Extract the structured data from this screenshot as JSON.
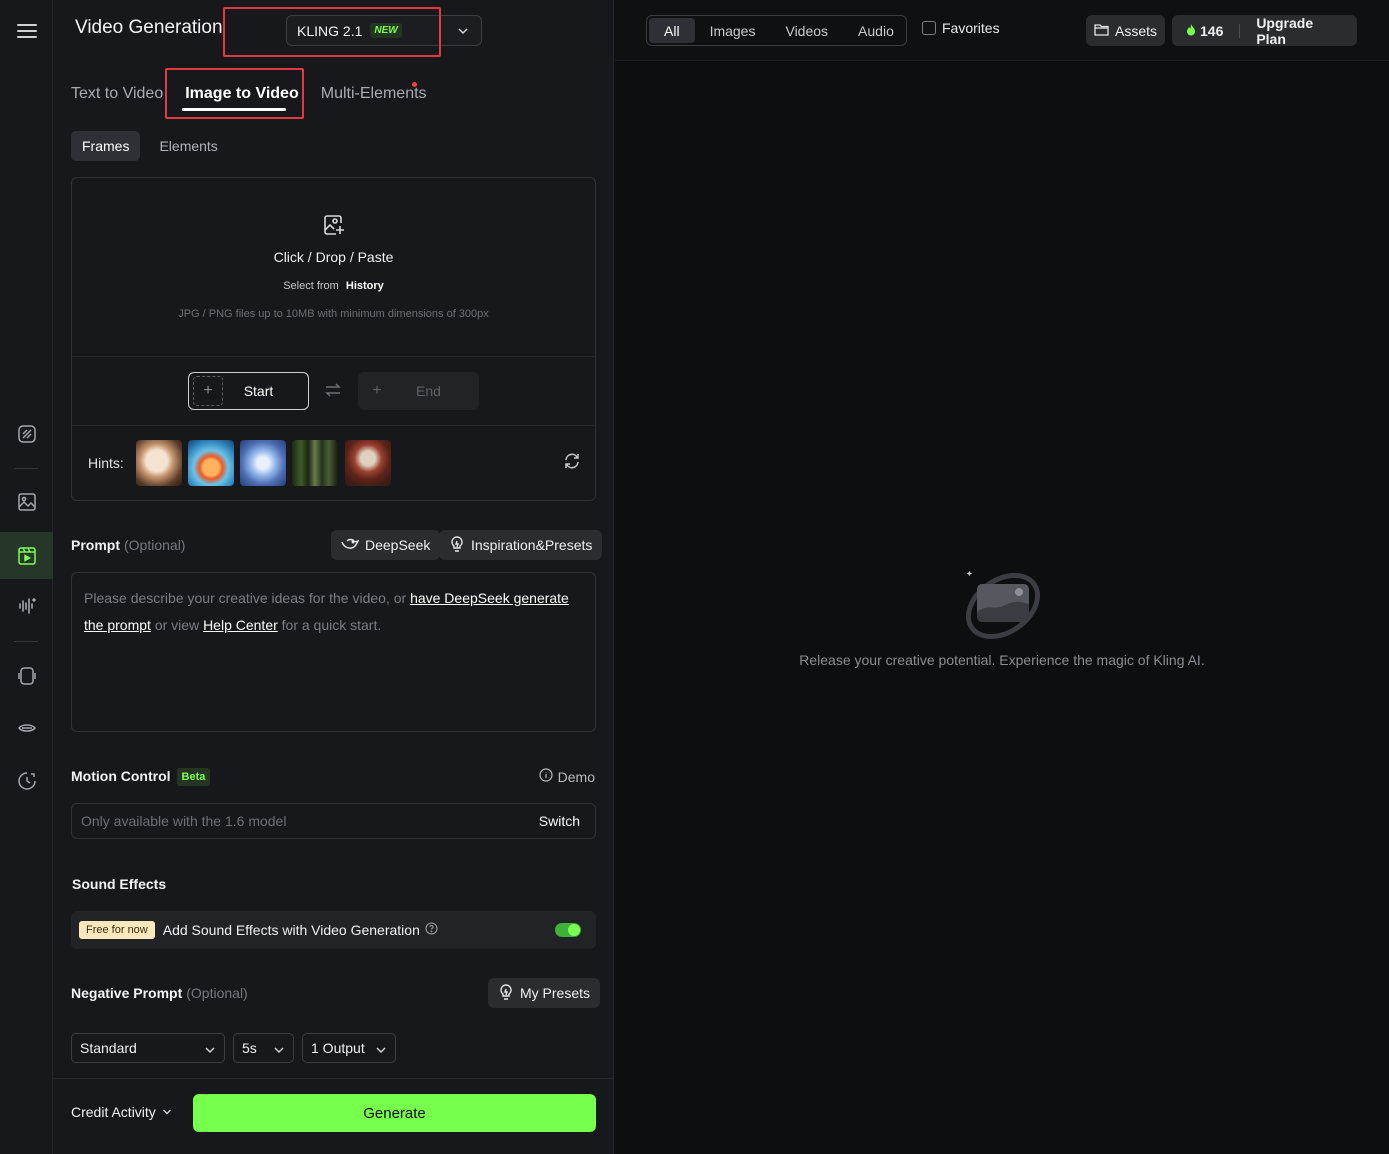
{
  "panel": {
    "title": "Video Generation",
    "model": {
      "name": "KLING 2.1",
      "badge": "NEW"
    }
  },
  "tabs": [
    {
      "label": "Text to Video",
      "active": false
    },
    {
      "label": "Image to Video",
      "active": true
    },
    {
      "label": "Multi-Elements",
      "active": false
    }
  ],
  "subtabs": [
    {
      "label": "Frames",
      "active": true
    },
    {
      "label": "Elements",
      "active": false
    }
  ],
  "upload": {
    "title": "Click / Drop / Paste",
    "select_from": "Select from",
    "history": "History",
    "file_hint": "JPG / PNG files up to 10MB with minimum dimensions of 300px",
    "start_label": "Start",
    "end_label": "End",
    "hints_label": "Hints:"
  },
  "prompt": {
    "label": "Prompt",
    "optional": "(Optional)",
    "deepseek_btn": "DeepSeek",
    "presets_btn": "Inspiration&Presets",
    "placeholder_1": "Please describe your creative ideas for the video, or ",
    "link_1": "have DeepSeek generate the prompt",
    "placeholder_2": " or view ",
    "link_2": "Help Center",
    "placeholder_3": " for a quick start."
  },
  "motion": {
    "label": "Motion Control",
    "badge": "Beta",
    "demo": "Demo",
    "placeholder": "Only available with the 1.6 model",
    "switch": "Switch"
  },
  "sound": {
    "label": "Sound Effects",
    "badge": "Free for now",
    "text": "Add Sound Effects with Video Generation",
    "enabled": true
  },
  "negative": {
    "label": "Negative Prompt",
    "optional": "(Optional)",
    "presets_btn": "My Presets"
  },
  "settings": {
    "mode": "Standard",
    "duration": "5s",
    "outputs": "1 Output"
  },
  "footer": {
    "credit_activity": "Credit Activity",
    "generate": "Generate"
  },
  "topbar": {
    "filters": [
      "All",
      "Images",
      "Videos",
      "Audio"
    ],
    "active_filter": "All",
    "favorites": "Favorites",
    "assets": "Assets",
    "credits": "146",
    "upgrade": "Upgrade Plan"
  },
  "empty_state": "Release your creative potential. Experience the magic of Kling AI.",
  "colors": {
    "accent": "#76ff4d",
    "highlight_box": "#e5393f",
    "background": "#17181b"
  }
}
